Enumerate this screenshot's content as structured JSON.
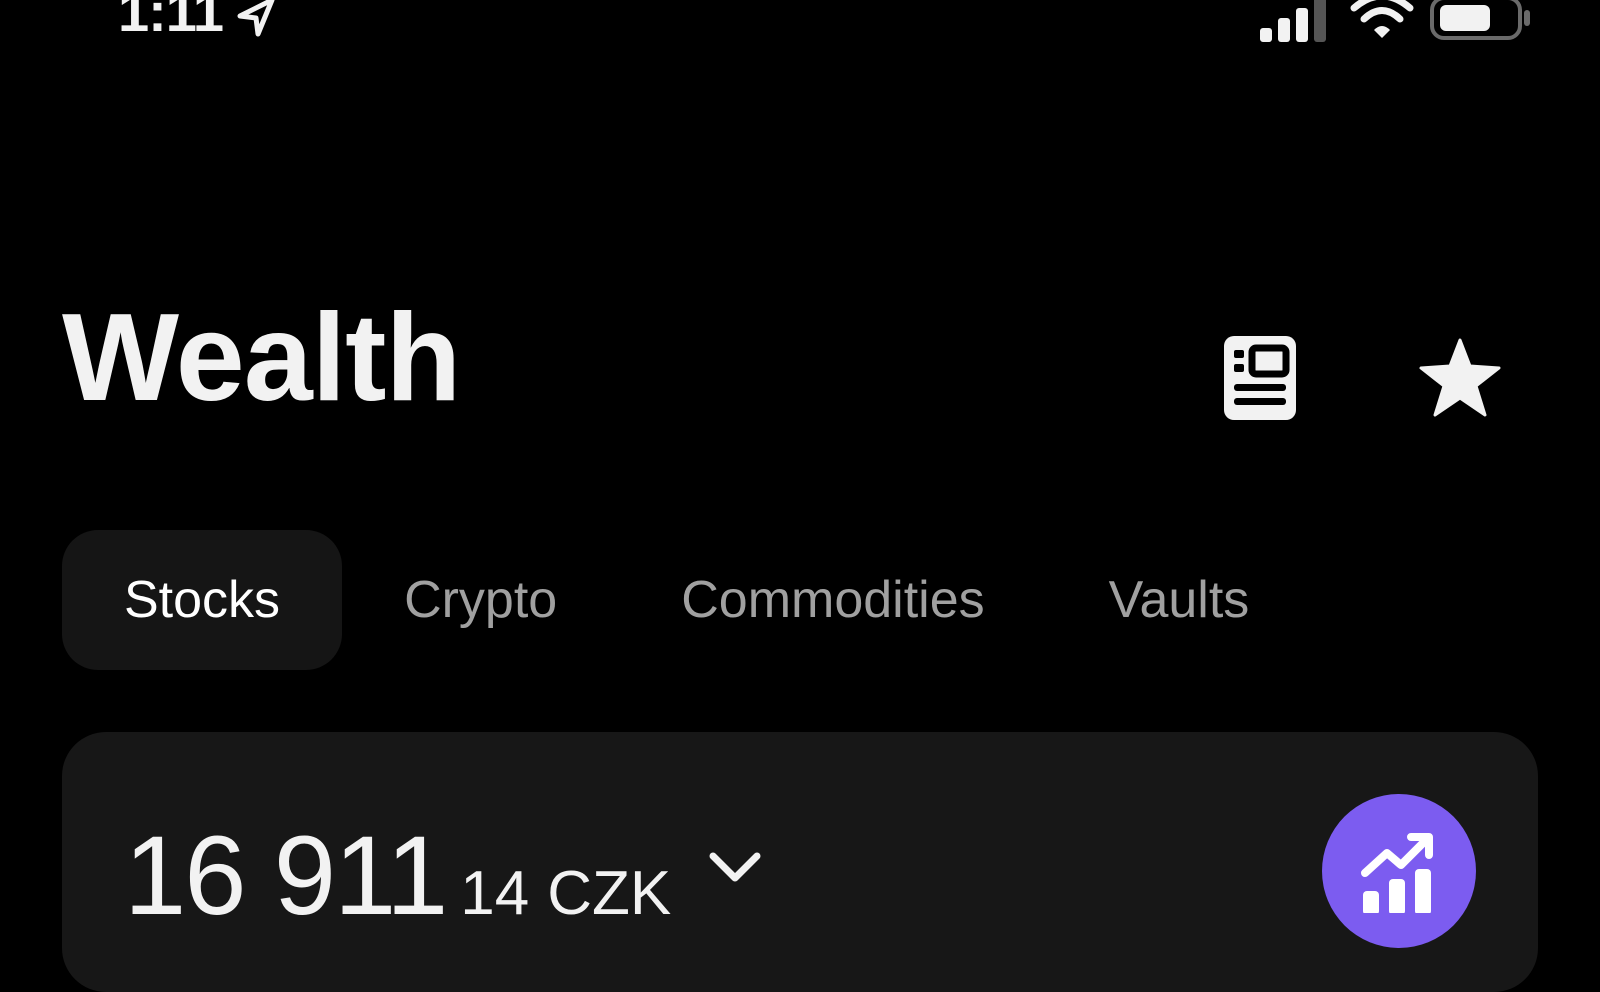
{
  "status_bar": {
    "time": "1:11",
    "icons": [
      "location-arrow-icon",
      "cellular-signal-icon",
      "wifi-icon",
      "battery-icon"
    ]
  },
  "header": {
    "title": "Wealth",
    "actions": [
      {
        "name": "news",
        "icon": "news-document-icon"
      },
      {
        "name": "watchlist",
        "icon": "star-icon"
      }
    ]
  },
  "tabs": [
    {
      "label": "Stocks",
      "active": true
    },
    {
      "label": "Crypto",
      "active": false
    },
    {
      "label": "Commodities",
      "active": false
    },
    {
      "label": "Vaults",
      "active": false
    }
  ],
  "balance": {
    "integer_part": "16 911",
    "decimal_part": "14",
    "currency": "CZK",
    "dropdown_icon": "chevron-down-icon",
    "action_icon": "trending-chart-icon"
  },
  "colors": {
    "background": "#000000",
    "text": "#f2f2f2",
    "tab_inactive": "#a0a0a0",
    "tab_active_bg": "#151515",
    "card_bg": "#171717",
    "accent": "#7c5cf0"
  }
}
